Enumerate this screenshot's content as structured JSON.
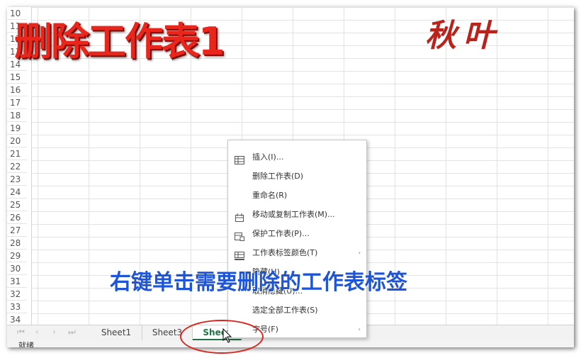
{
  "rows": [
    "10",
    "11",
    "12",
    "13",
    "14",
    "15",
    "16",
    "17",
    "18",
    "19",
    "20",
    "21",
    "22",
    "23",
    "24",
    "25",
    "26",
    "27",
    "28",
    "29",
    "30",
    "31",
    "32",
    "33",
    "34"
  ],
  "title_overlay": "删除工作表1",
  "signature": "秋叶",
  "caption": "右键单击需要删除的工作表标签",
  "tabs": [
    {
      "label": "Sheet1"
    },
    {
      "label": "Sheet3"
    },
    {
      "label": "Sheet"
    }
  ],
  "active_tab": "Sheet",
  "nav_arrows": [
    "|<",
    "<",
    ">",
    ">|"
  ],
  "context_menu": [
    {
      "label": "插入(I)...",
      "icon": "insert-table-icon"
    },
    {
      "label": "删除工作表(D)",
      "icon": ""
    },
    {
      "label": "重命名(R)",
      "icon": ""
    },
    {
      "label": "移动或复制工作表(M)...",
      "icon": "move-copy-icon"
    },
    {
      "label": "保护工作表(P)...",
      "icon": "protect-sheet-icon"
    },
    {
      "label": "工作表标签颜色(T)",
      "icon": "tab-color-icon",
      "submenu": true
    },
    {
      "label": "隐藏(H)",
      "icon": ""
    },
    {
      "label": "取消隐藏(U)...",
      "icon": ""
    },
    {
      "label": "选定全部工作表(S)",
      "icon": ""
    },
    {
      "label": "字号(F)",
      "icon": "",
      "submenu": true
    }
  ],
  "submenu_arrow": "›",
  "status_text": "就绪",
  "colors": {
    "accent": "#217346",
    "title": "#e8261c",
    "caption": "#1e55d8",
    "highlight": "#d8261e"
  }
}
